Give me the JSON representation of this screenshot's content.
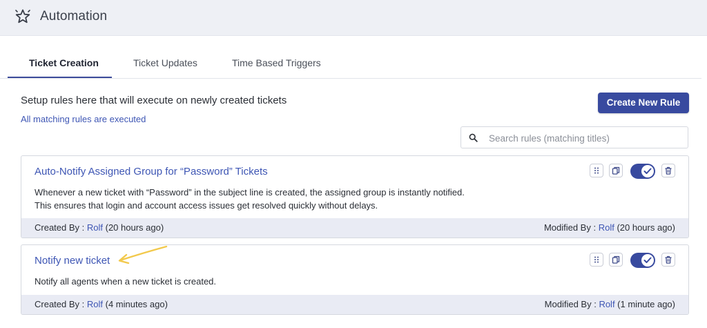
{
  "header": {
    "title": "Automation",
    "icon": "star-icon"
  },
  "tabs": [
    {
      "label": "Ticket Creation",
      "active": true
    },
    {
      "label": "Ticket Updates",
      "active": false
    },
    {
      "label": "Time Based Triggers",
      "active": false
    }
  ],
  "setup_text": "Setup rules here that will execute on newly created tickets",
  "matching_text": "All matching rules are executed",
  "create_button": "Create New Rule",
  "search": {
    "placeholder": "Search rules (matching titles)",
    "value": ""
  },
  "rules": [
    {
      "title": "Auto-Notify Assigned Group for “Password” Tickets",
      "description_lines": [
        "Whenever a new ticket with “Password” in the subject line is created, the assigned group is instantly notified.",
        "This ensures that login and account access issues get resolved quickly without delays."
      ],
      "created_label": "Created By : ",
      "created_by": "Rolf",
      "created_time": " (20 hours ago)",
      "modified_label": "Modified By : ",
      "modified_by": "Rolf",
      "modified_time": " (20 hours ago)",
      "enabled": true
    },
    {
      "title": "Notify new ticket",
      "description_lines": [
        "Notify all agents when a new ticket is created."
      ],
      "created_label": "Created By : ",
      "created_by": "Rolf",
      "created_time": " (4 minutes ago)",
      "modified_label": "Modified By : ",
      "modified_by": "Rolf",
      "modified_time": " (1 minute ago)",
      "enabled": true
    }
  ],
  "colors": {
    "accent": "#384a9f",
    "link": "#3e56b4",
    "footer_bg": "#e9ebf4",
    "annotation_arrow": "#f2c94c"
  }
}
